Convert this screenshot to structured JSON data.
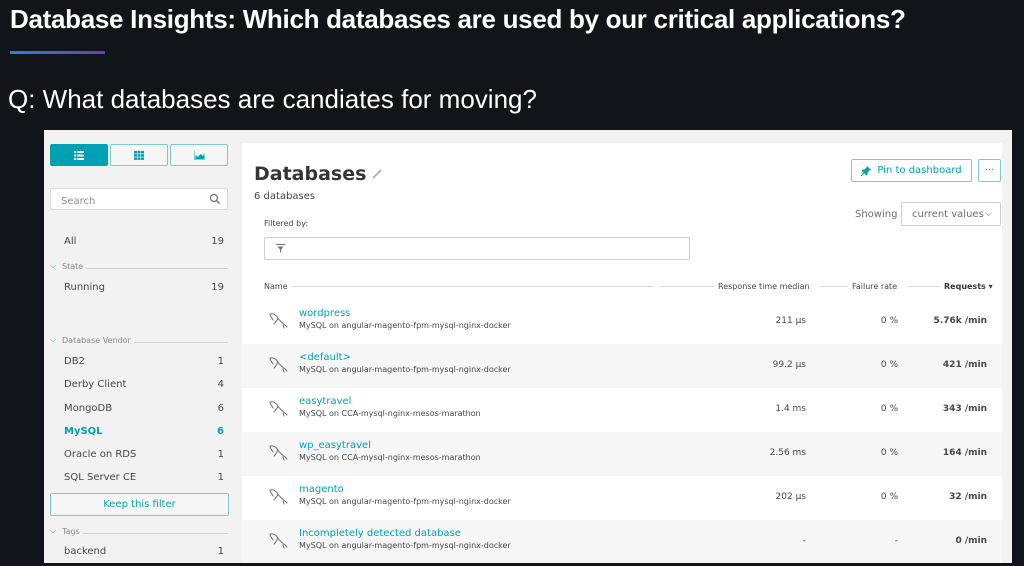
{
  "slide": {
    "title": "Database Insights: Which databases are used by our critical applications?",
    "question": "Q: What databases are candiates for moving?",
    "accent_gradient": [
      "#2f7de3",
      "#6b3ea8"
    ]
  },
  "colors": {
    "accent": "#00a1b2",
    "text": "#454646",
    "background": "#111419",
    "panel": "#ffffff",
    "frame": "#f2f2f2"
  },
  "sidebar": {
    "view_toggle": [
      {
        "icon": "list-icon",
        "active": true
      },
      {
        "icon": "grid-icon",
        "active": false
      },
      {
        "icon": "chart-icon",
        "active": false
      }
    ],
    "search_placeholder": "Search",
    "all": {
      "label": "All",
      "count": "19"
    },
    "sections": [
      {
        "label": "State",
        "items": [
          {
            "label": "Running",
            "count": "19"
          }
        ]
      },
      {
        "label": "Database Vendor",
        "items": [
          {
            "label": "DB2",
            "count": "1"
          },
          {
            "label": "Derby Client",
            "count": "4"
          },
          {
            "label": "MongoDB",
            "count": "6"
          },
          {
            "label": "MySQL",
            "count": "6",
            "selected": true
          },
          {
            "label": "Oracle on RDS",
            "count": "1"
          },
          {
            "label": "SQL Server CE",
            "count": "1"
          }
        ]
      },
      {
        "label": "Tags",
        "items": [
          {
            "label": "backend",
            "count": "1"
          }
        ]
      }
    ],
    "keep_filter_label": "Keep this filter"
  },
  "main": {
    "title": "Databases",
    "subtitle": "6 databases",
    "pin_label": "Pin to dashboard",
    "more_label": "···",
    "showing_label": "Showing",
    "showing_value": "current values",
    "filtered_label": "Filtered by:",
    "filter_value": "",
    "columns": {
      "name": "Name",
      "response_time": "Response time median",
      "failure_rate": "Failure rate",
      "requests": "Requests ▾"
    },
    "rows": [
      {
        "name": "wordpress",
        "host": "MySQL on angular-magento-fpm-mysql-nginx-docker",
        "response_time": "211 µs",
        "failure_rate": "0 %",
        "requests": "5.76k /min"
      },
      {
        "name": "<default>",
        "host": "MySQL on angular-magento-fpm-mysql-nginx-docker",
        "response_time": "99.2 µs",
        "failure_rate": "0 %",
        "requests": "421 /min"
      },
      {
        "name": "easytravel",
        "host": "MySQL on CCA-mysql-nginx-mesos-marathon",
        "response_time": "1.4 ms",
        "failure_rate": "0 %",
        "requests": "343 /min"
      },
      {
        "name": "wp_easytravel",
        "host": "MySQL on CCA-mysql-nginx-mesos-marathon",
        "response_time": "2.56 ms",
        "failure_rate": "0 %",
        "requests": "164 /min"
      },
      {
        "name": "magento",
        "host": "MySQL on angular-magento-fpm-mysql-nginx-docker",
        "response_time": "202 µs",
        "failure_rate": "0 %",
        "requests": "32 /min"
      },
      {
        "name": "Incompletely detected database",
        "host": "MySQL on angular-magento-fpm-mysql-nginx-docker",
        "response_time": "-",
        "failure_rate": "-",
        "requests": "0 /min"
      }
    ]
  }
}
